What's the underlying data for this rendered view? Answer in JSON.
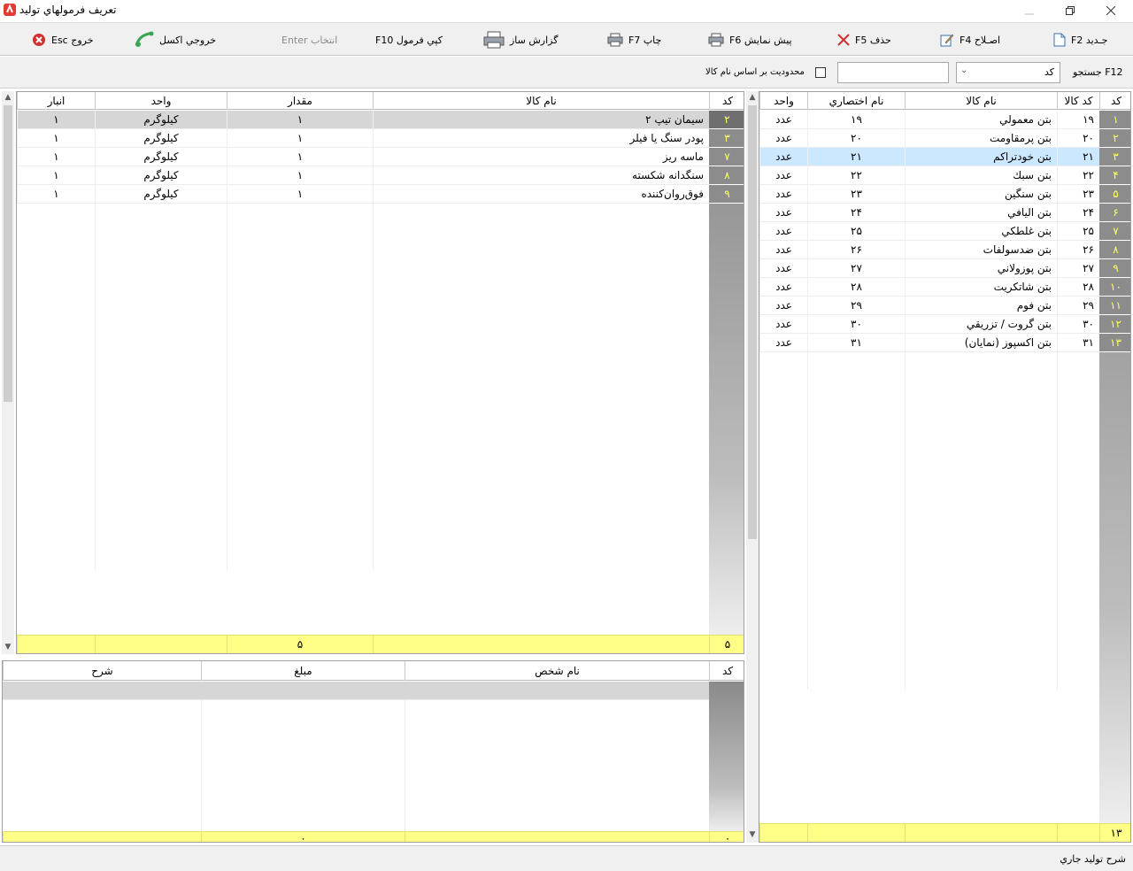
{
  "window": {
    "title": "تعريف فرمولهاي توليد"
  },
  "toolbar": {
    "new_label": "جـديد F2",
    "edit_label": "اصـلاح F4",
    "delete_label": "حذف F5",
    "preview_label": "پيش نمايش F6",
    "print_label": "چاپ F7",
    "report_label": "گزارش ساز",
    "copy_label": "كپي فرمول F10",
    "select_label": "انتخاب Enter",
    "excel_label": "خروجي اكسل",
    "exit_label": "خروج Esc"
  },
  "search": {
    "label": "جستجو F12",
    "field_value": "كد",
    "input_value": "",
    "limit_checkbox_label": "محدوديت بر اساس نام كالا",
    "limit_checked": false
  },
  "right_grid": {
    "headers": {
      "row": "كد",
      "code": "كد كالا",
      "name": "نام كالا",
      "short": "نام اختصاري",
      "unit": "واحد"
    },
    "rows": [
      {
        "row": "١",
        "code": "١٩",
        "name": "بتن معمولي",
        "short": "١٩",
        "unit": "عدد"
      },
      {
        "row": "٢",
        "code": "٢٠",
        "name": "بتن پرمقاومت",
        "short": "٢٠",
        "unit": "عدد"
      },
      {
        "row": "٣",
        "code": "٢١",
        "name": "بتن خودتراكم",
        "short": "٢١",
        "unit": "عدد"
      },
      {
        "row": "۴",
        "code": "٢٢",
        "name": "بتن سبك",
        "short": "٢٢",
        "unit": "عدد"
      },
      {
        "row": "۵",
        "code": "٢٣",
        "name": "بتن سنگين",
        "short": "٢٣",
        "unit": "عدد"
      },
      {
        "row": "۶",
        "code": "٢۴",
        "name": "بتن الیافي",
        "short": "٢۴",
        "unit": "عدد"
      },
      {
        "row": "٧",
        "code": "٢۵",
        "name": "بتن غلطكي",
        "short": "٢۵",
        "unit": "عدد"
      },
      {
        "row": "٨",
        "code": "٢۶",
        "name": "بتن ضدسولفات",
        "short": "٢۶",
        "unit": "عدد"
      },
      {
        "row": "٩",
        "code": "٢٧",
        "name": "بتن پوزولاني",
        "short": "٢٧",
        "unit": "عدد"
      },
      {
        "row": "١٠",
        "code": "٢٨",
        "name": "بتن شاتكريت",
        "short": "٢٨",
        "unit": "عدد"
      },
      {
        "row": "١١",
        "code": "٢٩",
        "name": "بتن فوم",
        "short": "٢٩",
        "unit": "عدد"
      },
      {
        "row": "١٢",
        "code": "٣٠",
        "name": "بتن گروت / تزريقي",
        "short": "٣٠",
        "unit": "عدد"
      },
      {
        "row": "١٣",
        "code": "٣١",
        "name": "بتن اكسپوز (نمايان)",
        "short": "٣١",
        "unit": "عدد"
      }
    ],
    "selected_row": 2,
    "footer_count": "١٣"
  },
  "materials_grid": {
    "headers": {
      "code": "كد",
      "name": "نام كالا",
      "qty": "مقدار",
      "unit": "واحد",
      "store": "انبار"
    },
    "rows": [
      {
        "code": "٢",
        "name": "سيمان تيپ ٢",
        "qty": "١",
        "unit": "كيلوگرم",
        "store": "١"
      },
      {
        "code": "٣",
        "name": "پودر سنگ يا فيلر",
        "qty": "١",
        "unit": "كيلوگرم",
        "store": "١"
      },
      {
        "code": "٧",
        "name": "ماسه ريز",
        "qty": "١",
        "unit": "كيلوگرم",
        "store": "١"
      },
      {
        "code": "٨",
        "name": "سنگدانه شكسته",
        "qty": "١",
        "unit": "كيلوگرم",
        "store": "١"
      },
      {
        "code": "٩",
        "name": "فوق‌روان‌كننده",
        "qty": "١",
        "unit": "كيلوگرم",
        "store": "١"
      }
    ],
    "footer_count": "۵",
    "footer_qty": "۵"
  },
  "costs_grid": {
    "headers": {
      "code": "كد",
      "person": "نام شخص",
      "amount": "مبلغ",
      "desc": "شرح"
    },
    "footer_code": "٠",
    "footer_amount": "٠"
  },
  "status": {
    "text": "شرح توليد جاري"
  },
  "colors": {
    "footer": "#ffff88",
    "indicator_text": "#ffff66",
    "selection": "#cce8ff"
  }
}
